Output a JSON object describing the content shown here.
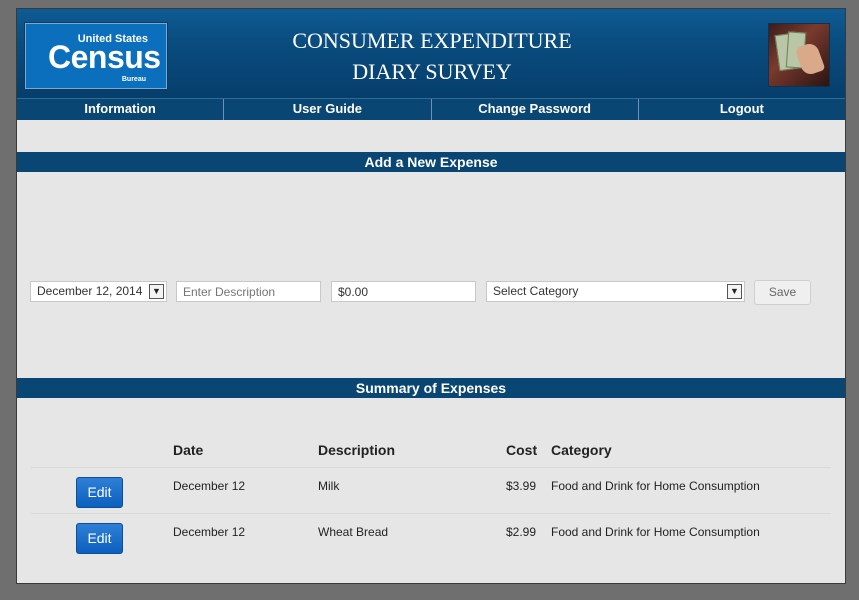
{
  "header": {
    "logo": {
      "top": "United States",
      "main": "Census",
      "sub": "Bureau"
    },
    "title_line1": "CONSUMER EXPENDITURE",
    "title_line2": "DIARY SURVEY"
  },
  "nav": {
    "items": [
      {
        "label": "Information"
      },
      {
        "label": "User Guide"
      },
      {
        "label": "Change Password"
      },
      {
        "label": "Logout"
      }
    ]
  },
  "add_expense": {
    "heading": "Add a New Expense",
    "date_value": "December 12, 2014",
    "description_placeholder": "Enter Description",
    "cost_value": "$0.00",
    "category_value": "Select Category",
    "save_label": "Save"
  },
  "summary": {
    "heading": "Summary of Expenses",
    "columns": {
      "date": "Date",
      "description": "Description",
      "cost": "Cost",
      "category": "Category"
    },
    "rows": [
      {
        "edit_label": "Edit",
        "date": "December 12",
        "description": "Milk",
        "cost": "$3.99",
        "category": "Food and Drink for Home Consumption"
      },
      {
        "edit_label": "Edit",
        "date": "December 12",
        "description": "Wheat Bread",
        "cost": "$2.99",
        "category": "Food and Drink for Home Consumption"
      }
    ]
  },
  "icons": {
    "dropdown": "chevron-down-icon",
    "photo": "wallet-money-photo"
  },
  "colors": {
    "brand": "#0a4673",
    "edit_button": "#0b5fbe",
    "background": "#e6e6e6"
  }
}
